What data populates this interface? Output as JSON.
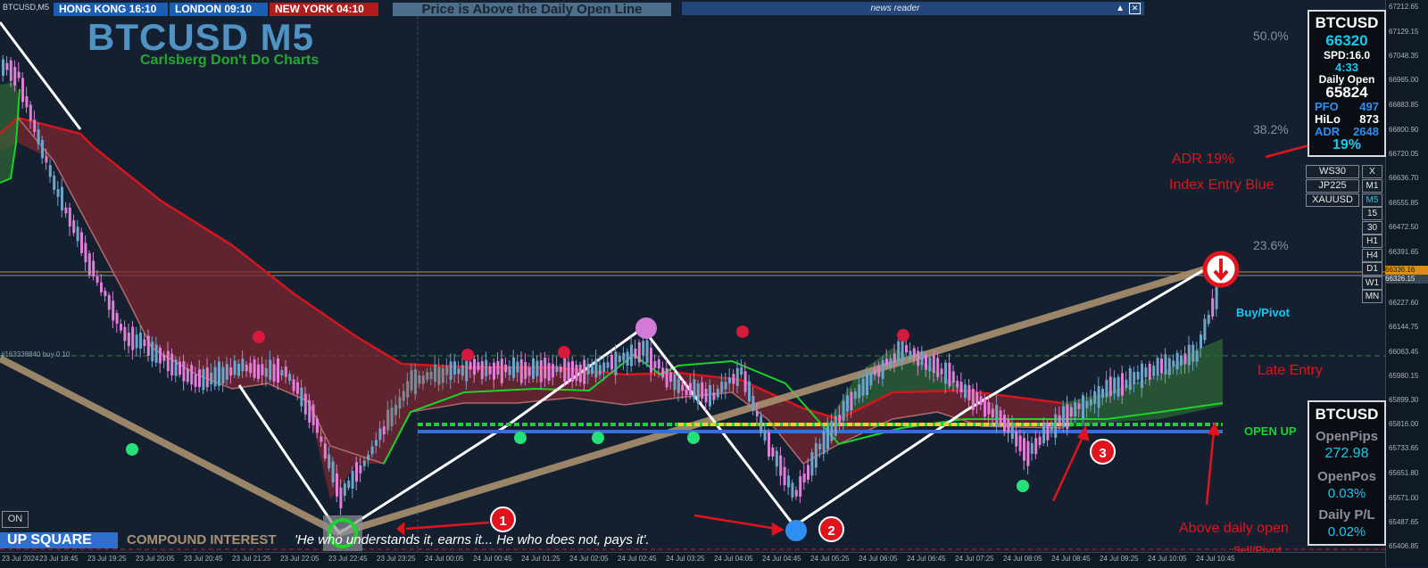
{
  "window": {
    "title": "BTCUSD,M5"
  },
  "clocks": [
    {
      "label": "HONG KONG 16:10",
      "color": "#1a5fb4"
    },
    {
      "label": "LONDON 09:10",
      "color": "#1a5fb4"
    },
    {
      "label": "NEW YORK 04:10",
      "color": "#b01c1c"
    }
  ],
  "status_banner": "Price is Above the Daily Open Line",
  "news_reader": {
    "title": "news reader",
    "collapse_glyph": "▲",
    "close_glyph": "✕"
  },
  "branding": {
    "title": "BTCUSD M5",
    "subtitle": "Carlsberg Don't Do Charts"
  },
  "fib_levels": [
    "50.0%",
    "38.2%",
    "23.6%"
  ],
  "price_axis": [
    "67212.65",
    "67129.15",
    "67048.35",
    "66965.00",
    "66883.85",
    "66800.90",
    "66720.05",
    "66636.70",
    "66555.85",
    "66472.50",
    "66391.65",
    "66227.60",
    "66144.75",
    "66063.45",
    "65980.15",
    "65899.30",
    "65816.00",
    "65733.65",
    "65651.80",
    "65571.00",
    "65487.65",
    "65406.85"
  ],
  "current_price_tags": [
    "66336.16",
    "66326.15"
  ],
  "order_label": "#163338840 buy 0.10",
  "time_axis": [
    "23 Jul 2024",
    "23 Jul 18:45",
    "23 Jul 19:25",
    "23 Jul 20:05",
    "23 Jul 20:45",
    "23 Jul 21:25",
    "23 Jul 22:05",
    "23 Jul 22:45",
    "23 Jul 23:25",
    "24 Jul 00:05",
    "24 Jul 00:45",
    "24 Jul 01:25",
    "24 Jul 02:05",
    "24 Jul 02:45",
    "24 Jul 03:25",
    "24 Jul 04:05",
    "24 Jul 04:45",
    "24 Jul 05:25",
    "24 Jul 06:05",
    "24 Jul 06:45",
    "24 Jul 07:25",
    "24 Jul 08:05",
    "24 Jul 08:45",
    "24 Jul 09:25",
    "24 Jul 10:05",
    "24 Jul 10:45"
  ],
  "info_panel": {
    "symbol": "BTCUSD",
    "price": "66320",
    "spread": "SPD:16.0",
    "countdown": "4:33",
    "daily_open_label": "Daily Open",
    "daily_open_value": "65824",
    "pfo_label": "PFO",
    "pfo_value": "497",
    "hilo_label": "HiLo",
    "hilo_value": "873",
    "adr_label": "ADR",
    "adr_value": "2648",
    "adr_pct": "19%"
  },
  "symbols": [
    "WS30",
    "JP225",
    "XAUUSD"
  ],
  "symbol_close": "X",
  "timeframes": [
    "M1",
    "M5",
    "15",
    "30",
    "H1",
    "H4",
    "D1",
    "W1",
    "MN"
  ],
  "active_timeframe": "M5",
  "pnl_panel": {
    "symbol": "BTCUSD",
    "open_pips_label": "OpenPips",
    "open_pips_value": "272.98",
    "open_pos_label": "OpenPos",
    "open_pos_value": "0.03%",
    "daily_pl_label": "Daily P/L",
    "daily_pl_value": "0.02%"
  },
  "chart_labels": {
    "buy_pivot": "Buy/Pivot",
    "open_up": "OPEN UP",
    "sell_pivot": "Sell/Pivot"
  },
  "annotations": {
    "adr": "ADR 19%",
    "index_entry": "Index Entry Blue",
    "late_entry": "Late Entry",
    "above_open": "Above daily open"
  },
  "badges": [
    "1",
    "2",
    "3"
  ],
  "bottom_bar": {
    "on_button": "ON",
    "up_square": "UP SQUARE",
    "compound": "COMPOUND INTEREST",
    "quote": "'He who understands it, earns it... He who does not, pays it'."
  },
  "colors": {
    "background": "#142030",
    "bull_candle": "#6ea4c7",
    "bear_candle": "#e07ed8",
    "ma_red": "#d6161e",
    "ma_green": "#19d42a",
    "trend_tan": "#a89070",
    "accent_cyan": "#16c9f0"
  }
}
